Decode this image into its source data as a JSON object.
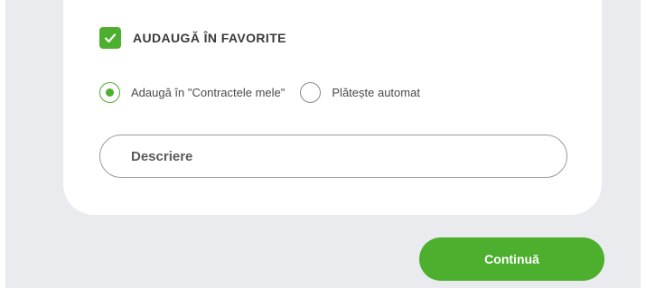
{
  "favorites": {
    "label": "AUDAUGĂ ÎN FAVORITE",
    "checked": true,
    "check_icon": "checkmark-icon"
  },
  "options": [
    {
      "label": "Adaugă în \"Contractele mele\"",
      "selected": true
    },
    {
      "label": "Plătește automat",
      "selected": false
    }
  ],
  "description": {
    "placeholder": "Descriere",
    "value": ""
  },
  "actions": {
    "continue_label": "Continuă"
  },
  "colors": {
    "accent": "#4caf2d",
    "background": "#e9ebee",
    "card": "#ffffff",
    "text": "#3a3a3a"
  }
}
